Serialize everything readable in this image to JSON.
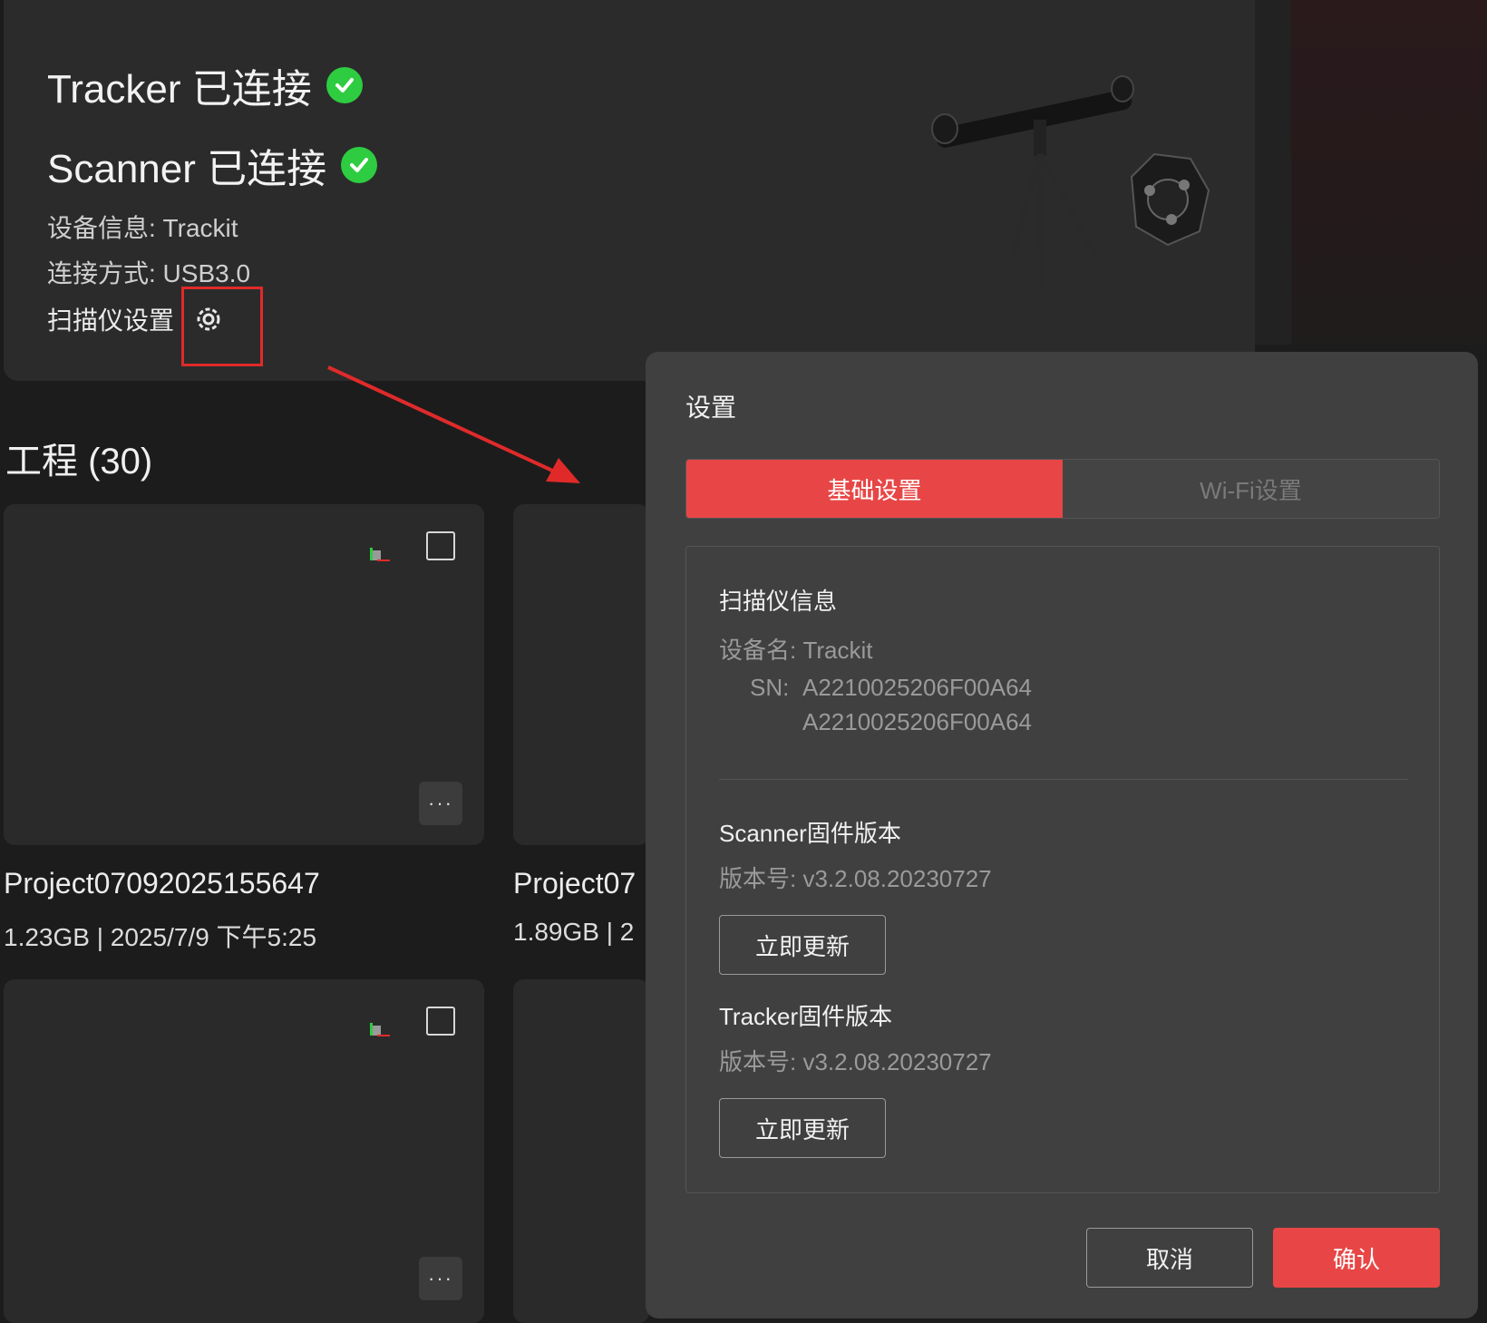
{
  "device": {
    "tracker_status": "Tracker 已连接",
    "scanner_status": "Scanner 已连接",
    "device_info": "设备信息: Trackit",
    "connection": "连接方式: USB3.0",
    "scanner_settings_label": "扫描仪设置"
  },
  "projects": {
    "title": "工程 (30)",
    "items": [
      {
        "name": "Project07092025155647",
        "meta": "1.23GB | 2025/7/9 下午5:25"
      },
      {
        "name": "Project07",
        "meta": "1.89GB | 2"
      }
    ],
    "more_label": "···"
  },
  "dialog": {
    "title": "设置",
    "tabs": [
      {
        "label": "基础设置",
        "active": true
      },
      {
        "label": "Wi-Fi设置",
        "active": false
      }
    ],
    "scanner_info": {
      "title": "扫描仪信息",
      "device_name": "设备名: Trackit",
      "sn_label": "SN:",
      "sn_1": "A2210025206F00A64",
      "sn_2": "A2210025206F00A64"
    },
    "scanner_fw": {
      "title": "Scanner固件版本",
      "version": "版本号: v3.2.08.20230727",
      "update_label": "立即更新"
    },
    "tracker_fw": {
      "title": "Tracker固件版本",
      "version": "版本号: v3.2.08.20230727",
      "update_label": "立即更新"
    },
    "cancel_label": "取消",
    "confirm_label": "确认"
  },
  "colors": {
    "accent": "#e84646",
    "success": "#2ecc40",
    "highlight": "#e02a2a"
  }
}
